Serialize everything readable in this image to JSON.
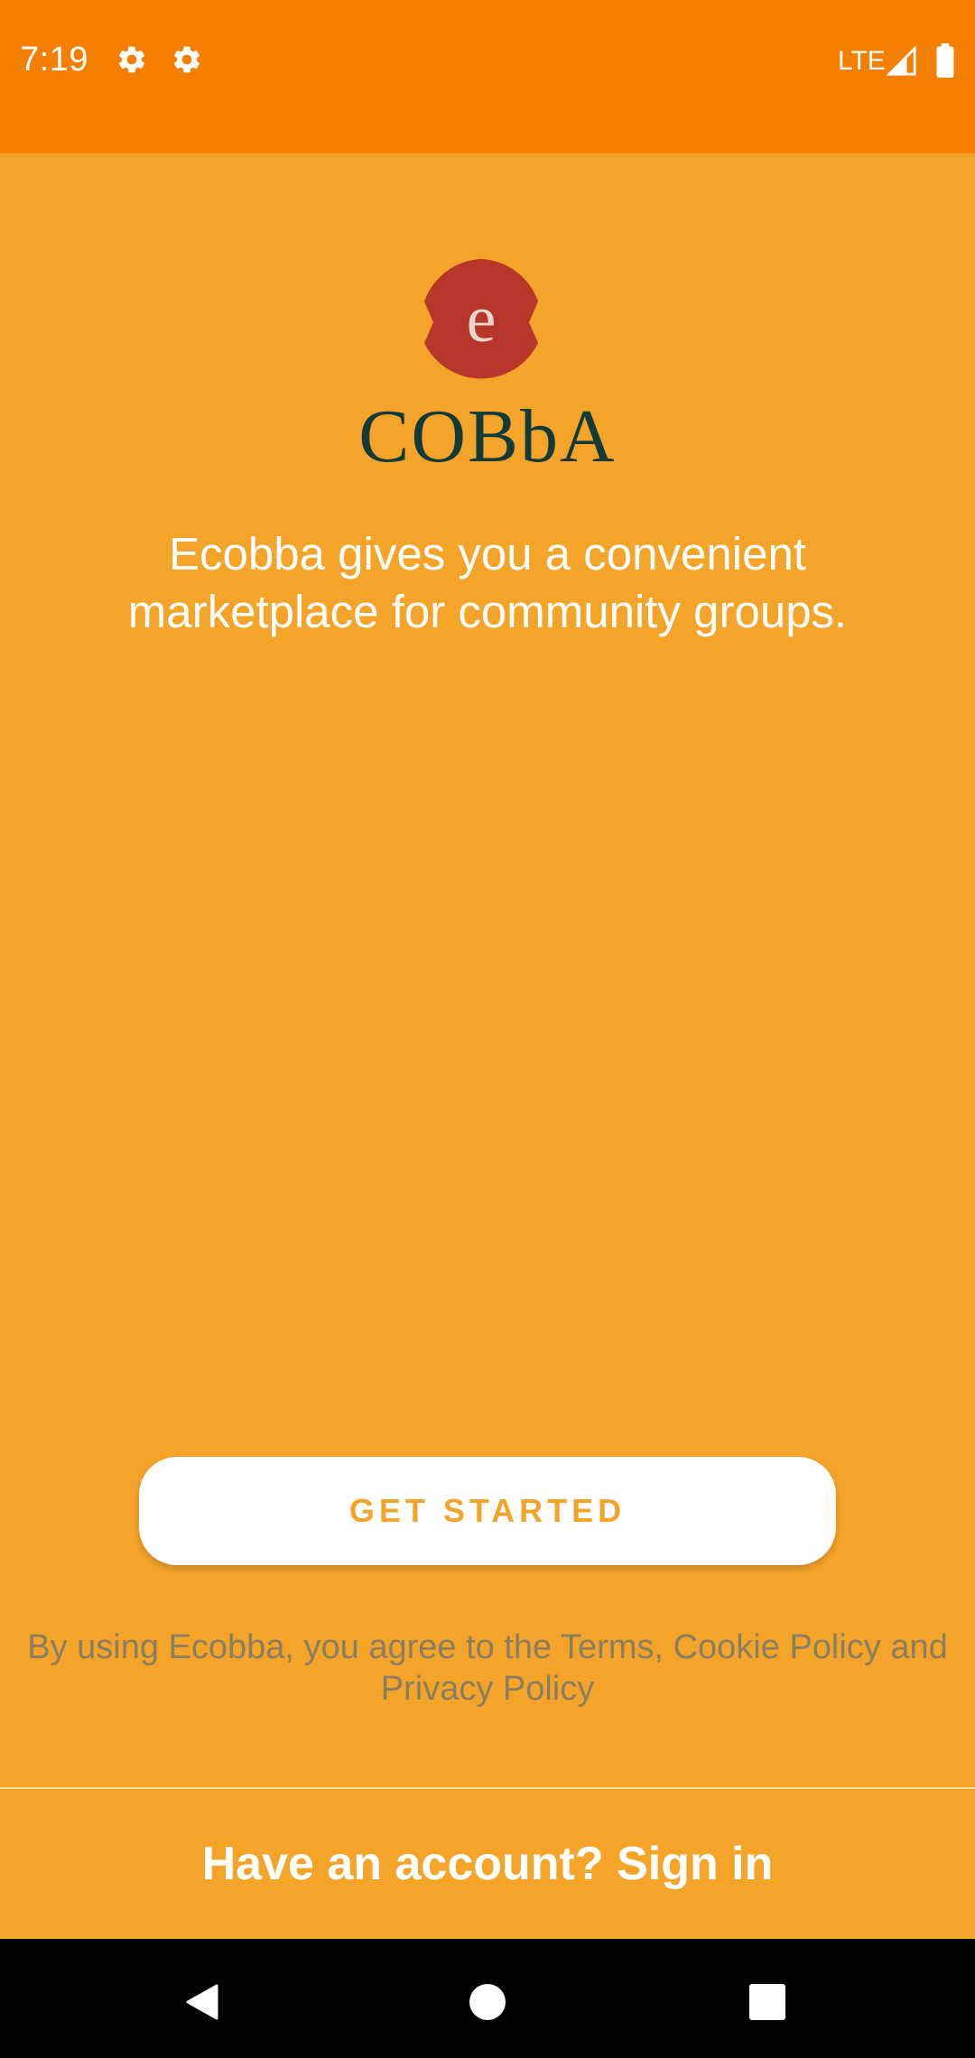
{
  "status_bar": {
    "time": "7:19",
    "network": "LTE",
    "icons": [
      "gear-icon",
      "gear-icon",
      "signal-icon",
      "battery-icon"
    ]
  },
  "logo": {
    "mark_letter": "e",
    "wordmark": "COBbA"
  },
  "tagline": "Ecobba gives you a convenient marketplace for community groups.",
  "get_started_label": "GET STARTED",
  "terms_text": "By using Ecobba, you agree to the Terms, Cookie Policy and Privacy Policy",
  "sign_in_label": "Have an account? Sign in",
  "nav": {
    "icons": [
      "back-icon",
      "home-icon",
      "recents-icon"
    ]
  },
  "colors": {
    "status_bar_bg": "#F57F02",
    "background": "#F5A42A",
    "accent": "#F5A42A",
    "logo_red": "#B6362A",
    "logo_text": "#123A38",
    "terms_text": "#8A7E62"
  }
}
